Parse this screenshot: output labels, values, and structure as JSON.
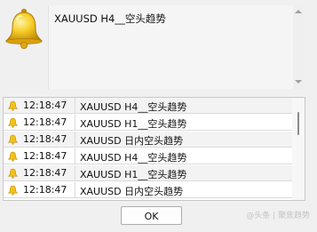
{
  "message": {
    "text": "XAUUSD H4__空头趋势",
    "icon": "bell-icon"
  },
  "alerts": [
    {
      "time": "12:18:47",
      "message": "XAUUSD H4__空头趋势",
      "icon": "bell-icon"
    },
    {
      "time": "12:18:47",
      "message": "XAUUSD H1__空头趋势",
      "icon": "bell-icon"
    },
    {
      "time": "12:18:47",
      "message": "XAUUSD 日内空头趋势",
      "icon": "bell-icon"
    },
    {
      "time": "12:18:47",
      "message": "XAUUSD H4__空头趋势",
      "icon": "bell-icon"
    },
    {
      "time": "12:18:47",
      "message": "XAUUSD H1__空头趋势",
      "icon": "bell-icon"
    },
    {
      "time": "12:18:47",
      "message": "XAUUSD 日内空头趋势",
      "icon": "bell-icon"
    }
  ],
  "buttons": {
    "ok_label": "OK"
  },
  "watermark": "@头条 | 聚焦趋势",
  "colors": {
    "bell_gold": "#f2c21a",
    "bell_dark": "#c48a06",
    "row_alt": "#f3f3f3"
  }
}
